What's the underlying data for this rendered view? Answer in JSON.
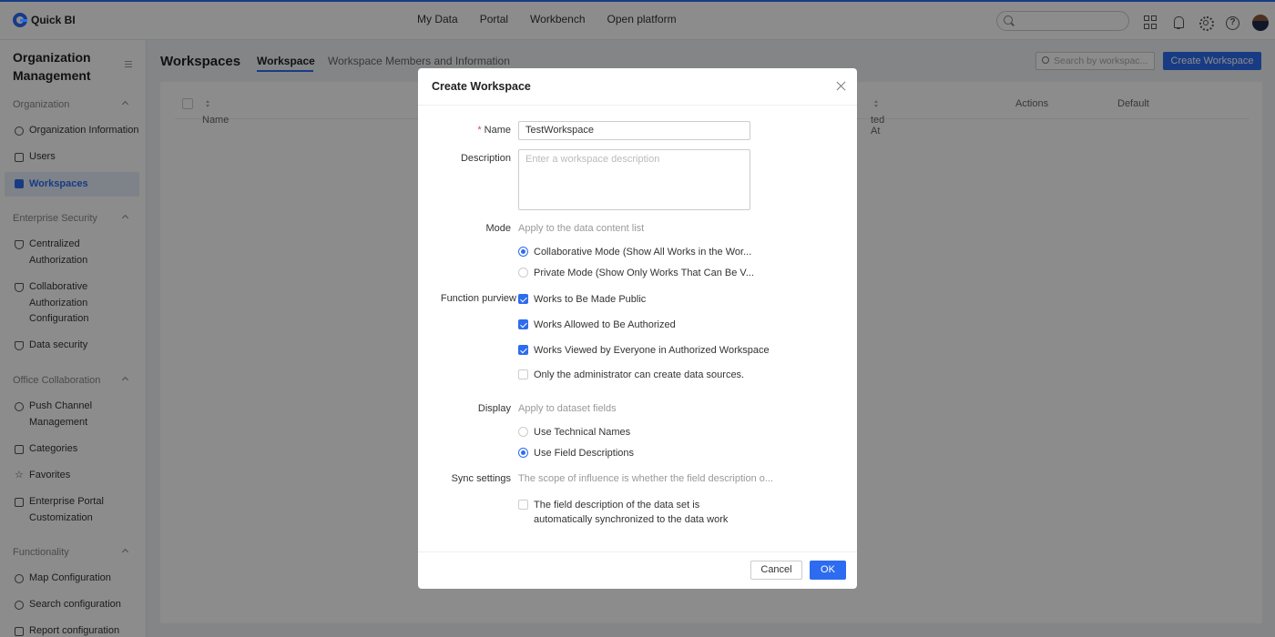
{
  "app": {
    "brand": "Quick BI"
  },
  "topnav": [
    "My Data",
    "Portal",
    "Workbench",
    "Open platform"
  ],
  "sidebar": {
    "title": "Organization Management",
    "sections": [
      {
        "label": "Organization",
        "items": [
          "Organization Information",
          "Users",
          "Workspaces"
        ]
      },
      {
        "label": "Enterprise Security",
        "items": [
          "Centralized Authorization",
          "Collaborative Authorization Configuration",
          "Data security"
        ]
      },
      {
        "label": "Office Collaboration",
        "items": [
          "Push Channel Management",
          "Categories",
          "Favorites",
          "Enterprise Portal Customization"
        ]
      },
      {
        "label": "Functionality",
        "items": [
          "Map Configuration",
          "Search configuration",
          "Report configuration"
        ]
      }
    ],
    "active_item": "Workspaces"
  },
  "main": {
    "title": "Workspaces",
    "tabs": [
      "Workspace",
      "Workspace Members and Information"
    ],
    "search_placeholder": "Search by workspac...",
    "create_label": "Create Workspace",
    "columns": [
      "Name",
      "ted At",
      "Actions",
      "Default"
    ]
  },
  "modal": {
    "title": "Create Workspace",
    "name_label": "Name",
    "name_value": "TestWorkspace",
    "description_label": "Description",
    "description_placeholder": "Enter a workspace description",
    "mode_label": "Mode",
    "mode_hint": "Apply to the data content list",
    "mode_options": [
      "Collaborative Mode (Show All Works in the Wor...",
      "Private Mode (Show Only Works That Can Be V..."
    ],
    "mode_selected": 0,
    "purview_label": "Function purview",
    "purview_options": [
      {
        "label": "Works to Be Made Public",
        "checked": true
      },
      {
        "label": "Works Allowed to Be Authorized",
        "checked": true
      },
      {
        "label": "Works Viewed by Everyone in Authorized Workspace",
        "checked": true
      },
      {
        "label": "Only the administrator can create data sources.",
        "checked": false
      }
    ],
    "display_label": "Display",
    "display_hint": "Apply to dataset fields",
    "display_options": [
      "Use Technical Names",
      "Use Field Descriptions"
    ],
    "display_selected": 1,
    "sync_label": "Sync settings",
    "sync_hint": "The scope of influence is whether the field description o...",
    "sync_option_line1": "The field description of the data set is",
    "sync_option_line2": "automatically synchronized to the data work",
    "sync_checked": false,
    "cancel_label": "Cancel",
    "ok_label": "OK"
  },
  "colors": {
    "accent": "#2d6cf0",
    "required": "#e54545"
  }
}
